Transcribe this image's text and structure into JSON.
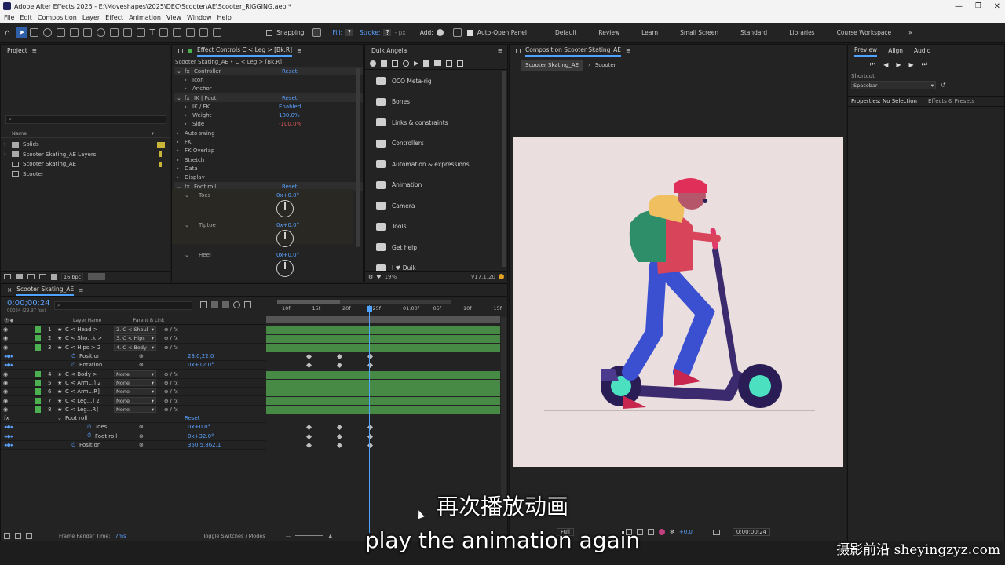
{
  "titlebar": {
    "title": "Adobe After Effects 2025 - E:\\Moveshapes\\2025\\DEC\\Scooter\\AE\\Scooter_RIGGING.aep *"
  },
  "menu": [
    "File",
    "Edit",
    "Composition",
    "Layer",
    "Effect",
    "Animation",
    "View",
    "Window",
    "Help"
  ],
  "toolbar": {
    "snapping": "Snapping",
    "fill_label": "Fill:",
    "fill_val": "?",
    "stroke_label": "Stroke:",
    "stroke_val": "?",
    "stroke_px": "- px",
    "add_label": "Add:",
    "auto_open": "Auto-Open Panel",
    "workspaces": [
      "Default",
      "Review",
      "Learn",
      "Small Screen",
      "Standard",
      "Libraries",
      "Course Workspace"
    ]
  },
  "project": {
    "title": "Project",
    "col_name": "Name",
    "items": [
      "Solids",
      "Scooter Skating_AE Layers",
      "Scooter Skating_AE",
      "Scooter"
    ],
    "bpc": "16 bpc"
  },
  "effect_controls": {
    "title": "Effect Controls C < Leg > [Bk.R]",
    "subtitle": "Scooter Skating_AE • C < Leg > [Bk.R]",
    "rows": [
      {
        "indent": 0,
        "label": "Controller",
        "value": "Reset",
        "fx": true
      },
      {
        "indent": 1,
        "label": "Icon",
        "value": ""
      },
      {
        "indent": 1,
        "label": "Anchor",
        "value": ""
      },
      {
        "indent": 0,
        "label": "IK | Foot",
        "value": "Reset",
        "fx": true
      },
      {
        "indent": 1,
        "label": "IK / FK",
        "value": "Enabled"
      },
      {
        "indent": 1,
        "label": "Weight",
        "value": "100.0%"
      },
      {
        "indent": 1,
        "label": "Side",
        "value": "-100.0%"
      },
      {
        "indent": 0,
        "label": "Auto swing",
        "value": ""
      },
      {
        "indent": 0,
        "label": "FK",
        "value": ""
      },
      {
        "indent": 0,
        "label": "FK Overlap",
        "value": ""
      },
      {
        "indent": 0,
        "label": "Stretch",
        "value": ""
      },
      {
        "indent": 0,
        "label": "Data",
        "value": ""
      },
      {
        "indent": 0,
        "label": "Display",
        "value": ""
      },
      {
        "indent": 0,
        "label": "Foot roll",
        "value": "Reset",
        "fx": true
      }
    ],
    "dials": [
      {
        "label": "Toes",
        "value": "0x+0.0°"
      },
      {
        "label": "Tiptoe",
        "value": "0x+0.0°"
      },
      {
        "label": "Heel",
        "value": "0x+0.0°"
      }
    ]
  },
  "duik": {
    "title": "Duik Angela",
    "items": [
      "OCO Meta-rig",
      "Bones",
      "Links & constraints",
      "Controllers",
      "Automation & expressions",
      "Animation",
      "Camera",
      "Tools",
      "Get help",
      "I ♥ Duik"
    ],
    "percent": "19%",
    "version": "v17.1.20"
  },
  "composition": {
    "title": "Composition Scooter Skating_AE",
    "tabs": [
      "Scooter Skating_AE",
      "Scooter"
    ],
    "bg_color": "#ebdede",
    "zoom": "Full",
    "exposure": "+0.0",
    "timecode": "0;00;00;24"
  },
  "preview": {
    "tabs": [
      "Preview",
      "Align",
      "Audio"
    ],
    "shortcut_label": "Shortcut",
    "shortcut_value": "Spacebar",
    "props_tab": "Properties: No Selection",
    "fx_tab": "Effects & Presets"
  },
  "timeline": {
    "tab": "Scooter Skating_AE",
    "timecode": "0;00;00;24",
    "timecode_sub": "00024 (29.97 fps)",
    "col_layer": "Layer Name",
    "col_parent": "Parent & Link",
    "ruler": [
      "10f",
      "15f",
      "20f",
      "25f",
      "01:00f",
      "05f",
      "10f",
      "15f"
    ],
    "layers": [
      {
        "type": "layer",
        "num": "1",
        "name": "C < Head >",
        "parent": "2. C < Shoul",
        "color": "#4db050"
      },
      {
        "type": "layer",
        "num": "2",
        "name": "C < Sho...k >",
        "parent": "3. C < Hips",
        "color": "#4db050"
      },
      {
        "type": "layer",
        "num": "3",
        "name": "C < Hips > 2",
        "parent": "4. C < Body",
        "color": "#4db050"
      },
      {
        "type": "prop",
        "name": "Position",
        "value": "23.0,22.0"
      },
      {
        "type": "prop",
        "name": "Rotation",
        "value": "0x+12.0°"
      },
      {
        "type": "layer",
        "num": "4",
        "name": "C < Body >",
        "parent": "None",
        "color": "#4db050"
      },
      {
        "type": "layer",
        "num": "5",
        "name": "C < Arm...] 2",
        "parent": "None",
        "color": "#4db050"
      },
      {
        "type": "layer",
        "num": "6",
        "name": "C < Arm...R]",
        "parent": "None",
        "color": "#4db050"
      },
      {
        "type": "layer",
        "num": "7",
        "name": "C < Leg...] 2",
        "parent": "None",
        "color": "#4db050"
      },
      {
        "type": "layer",
        "num": "8",
        "name": "C < Leg...R]",
        "parent": "None",
        "color": "#4db050"
      },
      {
        "type": "group",
        "name": "Foot roll",
        "value": "Reset"
      },
      {
        "type": "prop2",
        "name": "Toes",
        "value": "0x+0.0°"
      },
      {
        "type": "prop2",
        "name": "Foot roll",
        "value": "0x+32.0°"
      },
      {
        "type": "prop",
        "name": "Position",
        "value": "350.5,862.1"
      }
    ],
    "frame_render_label": "Frame Render Time:",
    "frame_render_value": "7ms",
    "toggle_label": "Toggle Switches / Modes"
  },
  "subtitles": {
    "zh": "再次播放动画",
    "en": "play the animation again",
    "watermark": "摄影前沿 sheyingzyz.com"
  }
}
